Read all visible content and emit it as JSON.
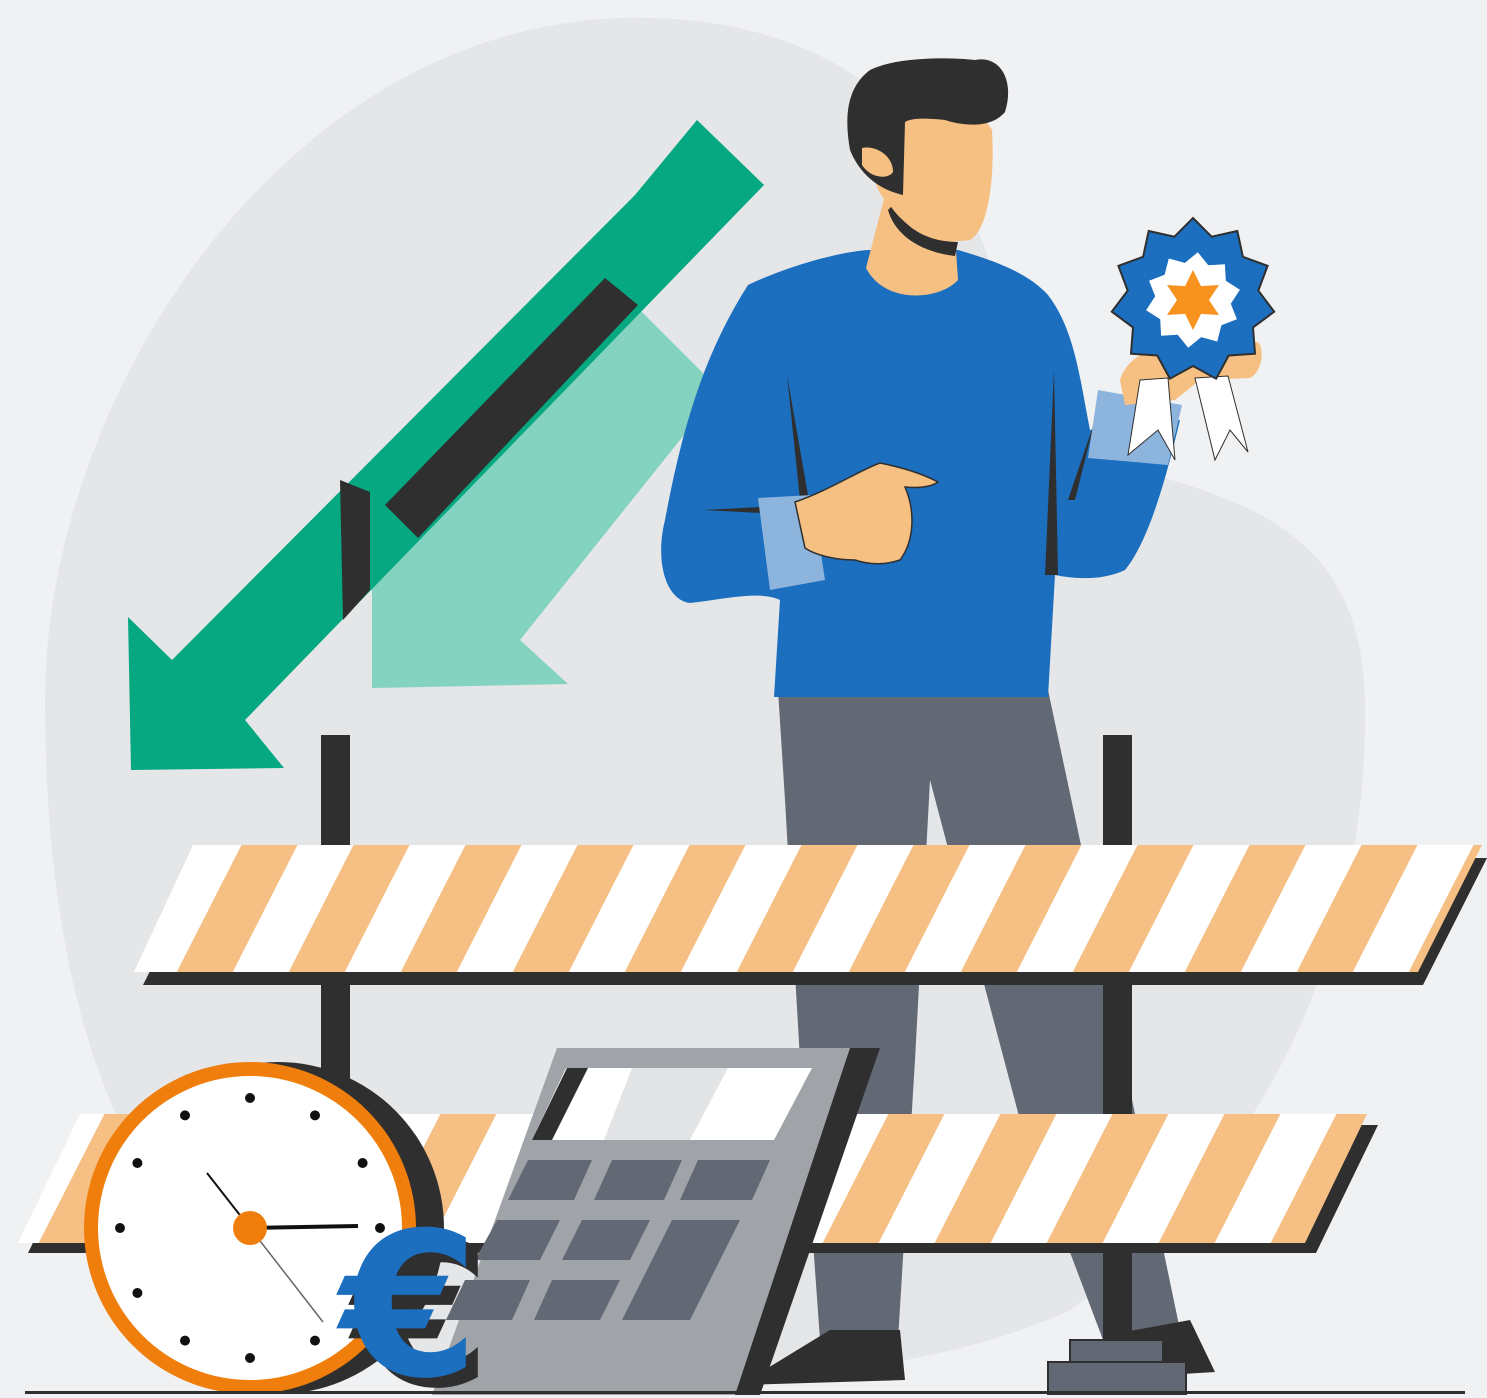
{
  "illustration": {
    "subject": "person-with-award-badge-behind-barriers",
    "elements": [
      "down-arrows",
      "person",
      "award-rosette",
      "road-barrier",
      "clock",
      "calculator",
      "euro-sign"
    ]
  },
  "labels": {
    "euro_symbol": "€"
  },
  "colors": {
    "background": "#f0f1f3",
    "blob": "#e4e6e8",
    "arrow_dark": "#05a880",
    "arrow_light": "#84d3c1",
    "shirt": "#1c6ebf",
    "cuff": "#8db4dc",
    "pants": "#626974",
    "skin": "#f6c083",
    "hair": "#2f2f2f",
    "barrier_orange": "#f6bf83",
    "barrier_white": "#ffffff",
    "clock_ring": "#ef7e0c",
    "calculator_body": "#a0a4a8",
    "calculator_keys": "#626974",
    "euro": "#1c6ebf",
    "rosette_star": "#f7931e"
  },
  "icons": {
    "arrow_primary": "down-left-arrow-icon",
    "arrow_secondary": "down-left-arrow-icon",
    "badge": "award-rosette-icon",
    "clock": "clock-icon",
    "calculator": "calculator-icon",
    "currency": "euro-icon"
  },
  "clock": {
    "hour_hand": "11",
    "minute_hand": "15",
    "second_hand": "25"
  }
}
